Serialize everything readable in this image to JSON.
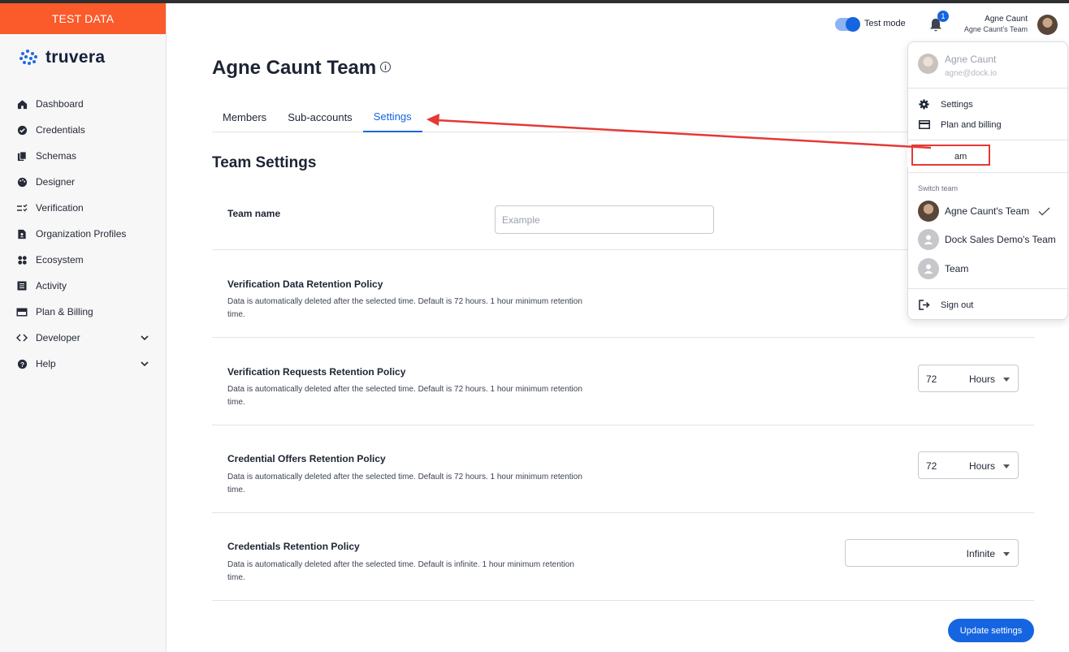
{
  "banner": {
    "label": "TEST DATA"
  },
  "brand": {
    "name": "truvera"
  },
  "sidebar": {
    "items": [
      {
        "label": "Dashboard",
        "icon": "home-icon"
      },
      {
        "label": "Credentials",
        "icon": "credential-badge-icon"
      },
      {
        "label": "Schemas",
        "icon": "documents-icon"
      },
      {
        "label": "Designer",
        "icon": "palette-icon"
      },
      {
        "label": "Verification",
        "icon": "checklist-icon"
      },
      {
        "label": "Organization Profiles",
        "icon": "profile-card-icon"
      },
      {
        "label": "Ecosystem",
        "icon": "ecosystem-icon"
      },
      {
        "label": "Activity",
        "icon": "activity-list-icon"
      },
      {
        "label": "Plan & Billing",
        "icon": "billing-card-icon"
      },
      {
        "label": "Developer",
        "icon": "code-icon",
        "expandable": true
      },
      {
        "label": "Help",
        "icon": "help-icon",
        "expandable": true
      }
    ]
  },
  "topbar": {
    "test_mode_label": "Test mode",
    "test_mode_on": true,
    "notification_count": "1",
    "user_name": "Agne Caunt",
    "user_team": "Agne Caunt's Team"
  },
  "page": {
    "title": "Agne Caunt Team",
    "tabs": [
      {
        "label": "Members",
        "active": false
      },
      {
        "label": "Sub-accounts",
        "active": false
      },
      {
        "label": "Settings",
        "active": true
      }
    ],
    "section_title": "Team Settings",
    "team_name": {
      "label": "Team name",
      "placeholder": "Example",
      "value": ""
    },
    "policies": [
      {
        "title": "Verification Data Retention Policy",
        "desc": "Data is automatically deleted after the selected time. Default is 72 hours. 1 hour minimum retention time.",
        "value": "",
        "unit": ""
      },
      {
        "title": "Verification Requests Retention Policy",
        "desc": "Data is automatically deleted after the selected time. Default is 72 hours. 1 hour minimum retention time.",
        "value": "72",
        "unit": "Hours"
      },
      {
        "title": "Credential Offers Retention Policy",
        "desc": "Data is automatically deleted after the selected time. Default is 72 hours. 1 hour minimum retention time.",
        "value": "72",
        "unit": "Hours"
      },
      {
        "title": "Credentials Retention Policy",
        "desc": "Data is automatically deleted after the selected time. Default is infinite. 1 hour minimum retention time.",
        "value": "",
        "unit": "Infinite"
      }
    ],
    "update_button": "Update settings"
  },
  "user_menu": {
    "name": "Agne Caunt",
    "email": "agne@dock.io",
    "items": [
      {
        "label": "Settings",
        "icon": "gear-icon"
      },
      {
        "label": "Plan and billing",
        "icon": "credit-card-icon"
      }
    ],
    "highlighted_item": "am",
    "switch_team_label": "Switch team",
    "teams": [
      {
        "label": "Agne Caunt's Team",
        "selected": true
      },
      {
        "label": "Dock Sales Demo's Team",
        "selected": false
      },
      {
        "label": "Team",
        "selected": false
      }
    ],
    "sign_out": "Sign out"
  },
  "colors": {
    "accent": "#1665e0",
    "banner": "#fb5a2a",
    "annotation": "#e53935"
  }
}
